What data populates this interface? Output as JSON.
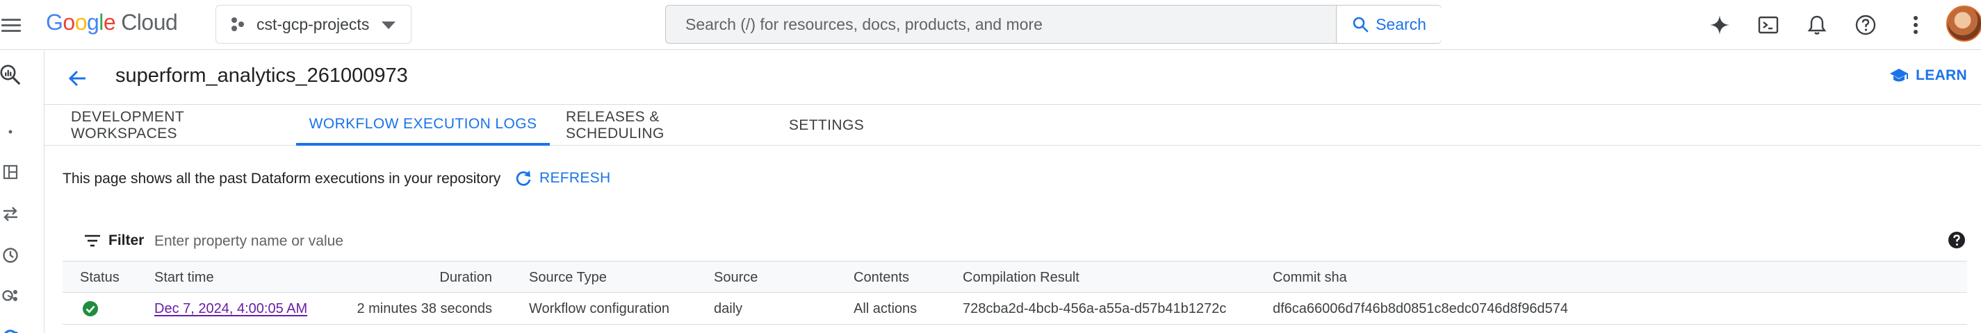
{
  "header": {
    "logo_google": "Google",
    "logo_cloud": "Cloud",
    "project": "cst-gcp-projects",
    "search_placeholder": "Search (/) for resources, docs, products, and more",
    "search_button": "Search"
  },
  "page": {
    "title": "superform_analytics_261000973",
    "learn_label": "LEARN"
  },
  "tabs": [
    {
      "label": "DEVELOPMENT WORKSPACES",
      "active": false
    },
    {
      "label": "WORKFLOW EXECUTION LOGS",
      "active": true
    },
    {
      "label": "RELEASES & SCHEDULING",
      "active": false
    },
    {
      "label": "SETTINGS",
      "active": false
    }
  ],
  "info": {
    "text": "This page shows all the past Dataform executions in your repository",
    "refresh_label": "REFRESH"
  },
  "filter": {
    "label": "Filter",
    "placeholder": "Enter property name or value"
  },
  "table": {
    "columns": [
      "Status",
      "Start time",
      "Duration",
      "Source Type",
      "Source",
      "Contents",
      "Compilation Result",
      "Commit sha"
    ],
    "rows": [
      {
        "status": "success",
        "start_time": "Dec 7, 2024, 4:00:05 AM",
        "duration": "2 minutes 38 seconds",
        "source_type": "Workflow configuration",
        "source": "daily",
        "contents": "All actions",
        "compilation_result": "728cba2d-4bcb-456a-a55a-d57b41b1272c",
        "commit_sha": "df6ca66006d7f46b8d0851c8edc0746d8f96d574"
      }
    ]
  },
  "colors": {
    "accent": "#1a73e8",
    "success": "#1e8e3e",
    "visited_link": "#681da8"
  }
}
